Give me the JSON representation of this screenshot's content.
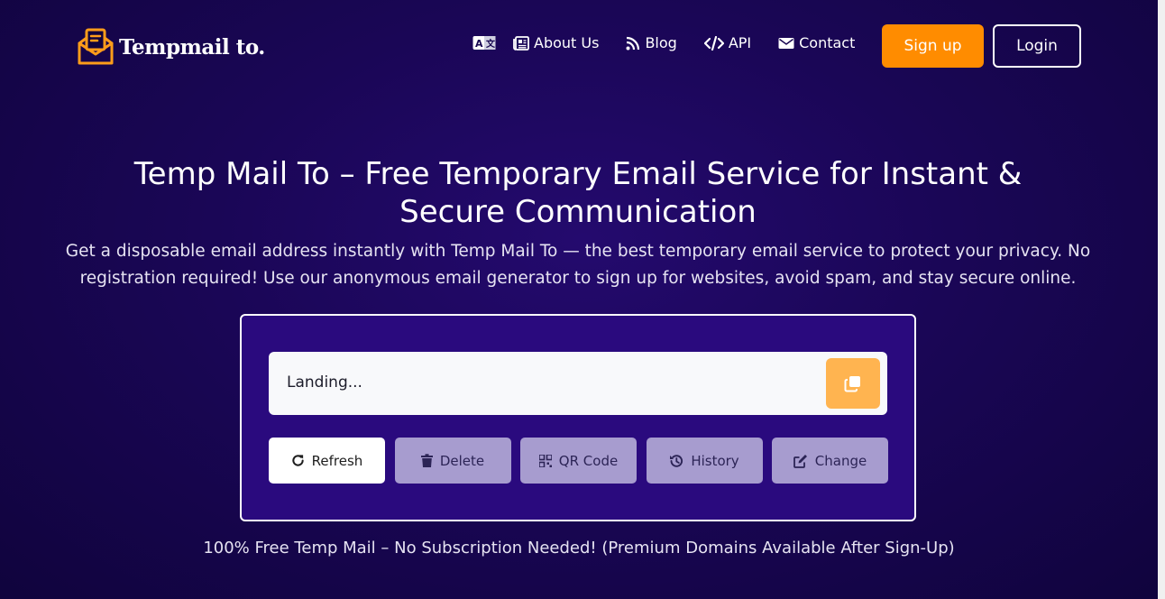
{
  "brand": {
    "name": "Tempmail to.",
    "accent": "#ff8c00",
    "icon": "envelope-logo-icon"
  },
  "nav": {
    "language_icon": "translate-icon",
    "items": [
      {
        "label": "About Us",
        "icon": "newspaper-icon"
      },
      {
        "label": "Blog",
        "icon": "rss-icon"
      },
      {
        "label": "API",
        "icon": "code-icon"
      },
      {
        "label": "Contact",
        "icon": "envelope-icon"
      }
    ],
    "signup_label": "Sign up",
    "login_label": "Login"
  },
  "hero": {
    "title": "Temp Mail To – Free Temporary Email Service for Instant & Secure Communication",
    "subtitle": "Get a disposable email address instantly with Temp Mail To — the best temporary email service to protect your privacy. No registration required! Use our anonymous email generator to sign up for websites, avoid spam, and stay secure online."
  },
  "mailbox": {
    "email_value": "Landing...",
    "copy_icon": "copy-icon",
    "actions": [
      {
        "label": "Refresh",
        "icon": "refresh-icon"
      },
      {
        "label": "Delete",
        "icon": "trash-icon"
      },
      {
        "label": "QR Code",
        "icon": "qrcode-icon"
      },
      {
        "label": "History",
        "icon": "history-icon"
      },
      {
        "label": "Change",
        "icon": "edit-icon"
      }
    ]
  },
  "footer_note": "100% Free Temp Mail – No Subscription Needed! (Premium Domains Available After Sign-Up)"
}
